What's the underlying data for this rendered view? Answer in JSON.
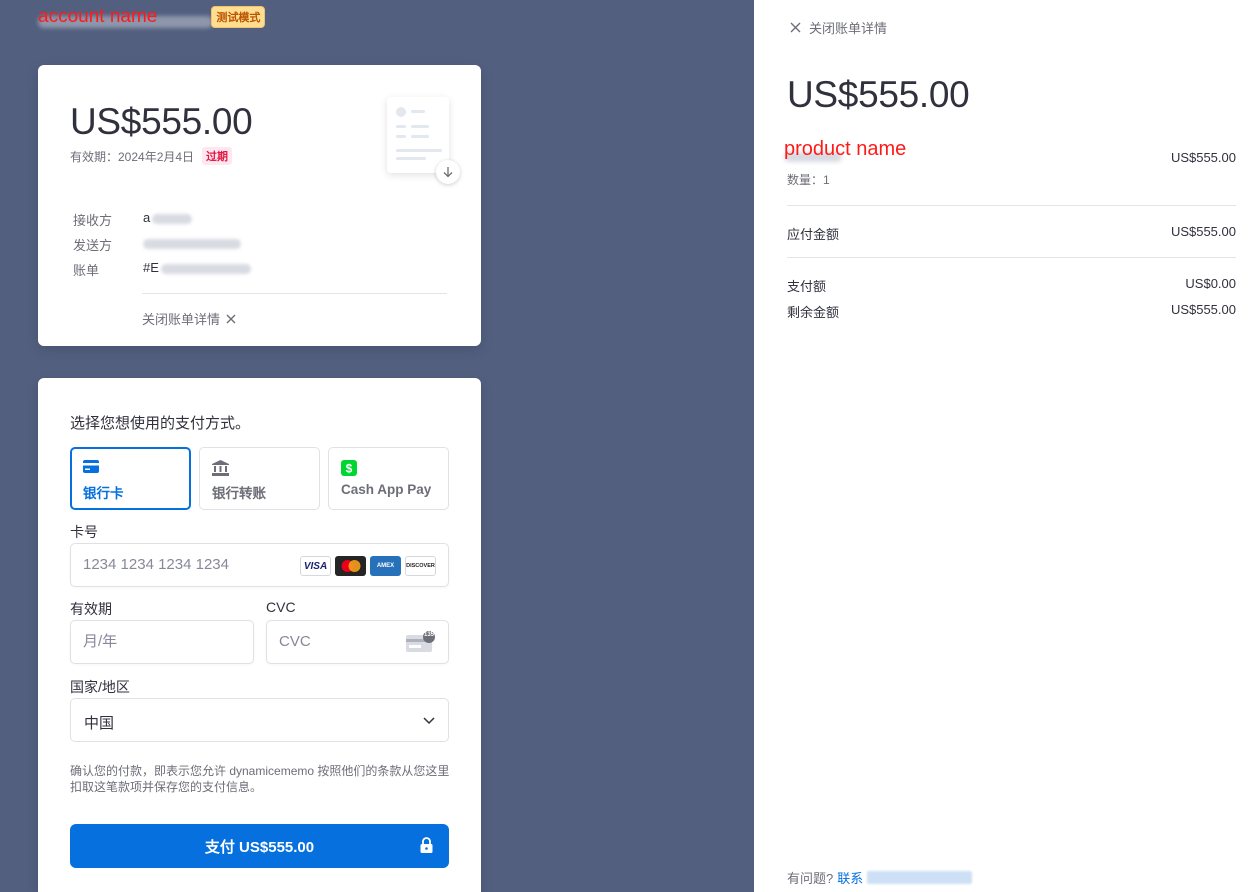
{
  "header": {
    "account_name": "account name",
    "test_mode_badge": "测试模式"
  },
  "invoice": {
    "amount": "US$555.00",
    "due_label": "有效期：2024年2月4日",
    "expired_badge": "过期",
    "recipient_label": "接收方",
    "recipient_value": "a",
    "sender_label": "发送方",
    "invoice_label": "账单",
    "invoice_value": "#E",
    "close_details": "关闭账单详情"
  },
  "payment": {
    "title": "选择您想使用的支付方式。",
    "tabs": [
      {
        "label": "银行卡",
        "icon": "card-icon",
        "active": true
      },
      {
        "label": "银行转账",
        "icon": "bank-icon",
        "active": false
      },
      {
        "label": "Cash App Pay",
        "icon": "cash-app-icon",
        "active": false
      }
    ],
    "card_number_label": "卡号",
    "card_number_placeholder": "1234 1234 1234 1234",
    "card_brands": [
      "VISA",
      "mastercard",
      "AMEX",
      "DISCOVER"
    ],
    "expiry_label": "有效期",
    "expiry_placeholder": "月/年",
    "cvc_label": "CVC",
    "cvc_placeholder": "CVC",
    "cvc_icon_text": "135",
    "country_label": "国家/地区",
    "country_value": "中国",
    "legal_text": "确认您的付款，即表示您允许 dynamicememo 按照他们的条款从您这里扣取这笔款项并保存您的支付信息。",
    "pay_button": "支付 US$555.00"
  },
  "details_panel": {
    "close_details": "关闭账单详情",
    "amount": "US$555.00",
    "product_name": "product name",
    "product_price": "US$555.00",
    "quantity": "数量：1",
    "amount_due_label": "应付金额",
    "amount_due_value": "US$555.00",
    "paid_label": "支付额",
    "paid_value": "US$0.00",
    "remaining_label": "剩余金额",
    "remaining_value": "US$555.00",
    "footer_question": "有问题?",
    "footer_contact": "联系"
  },
  "colors": {
    "background": "#525f7f",
    "accent": "#0570de",
    "annotation": "#ff1a1a",
    "expired": "#df1b41"
  }
}
